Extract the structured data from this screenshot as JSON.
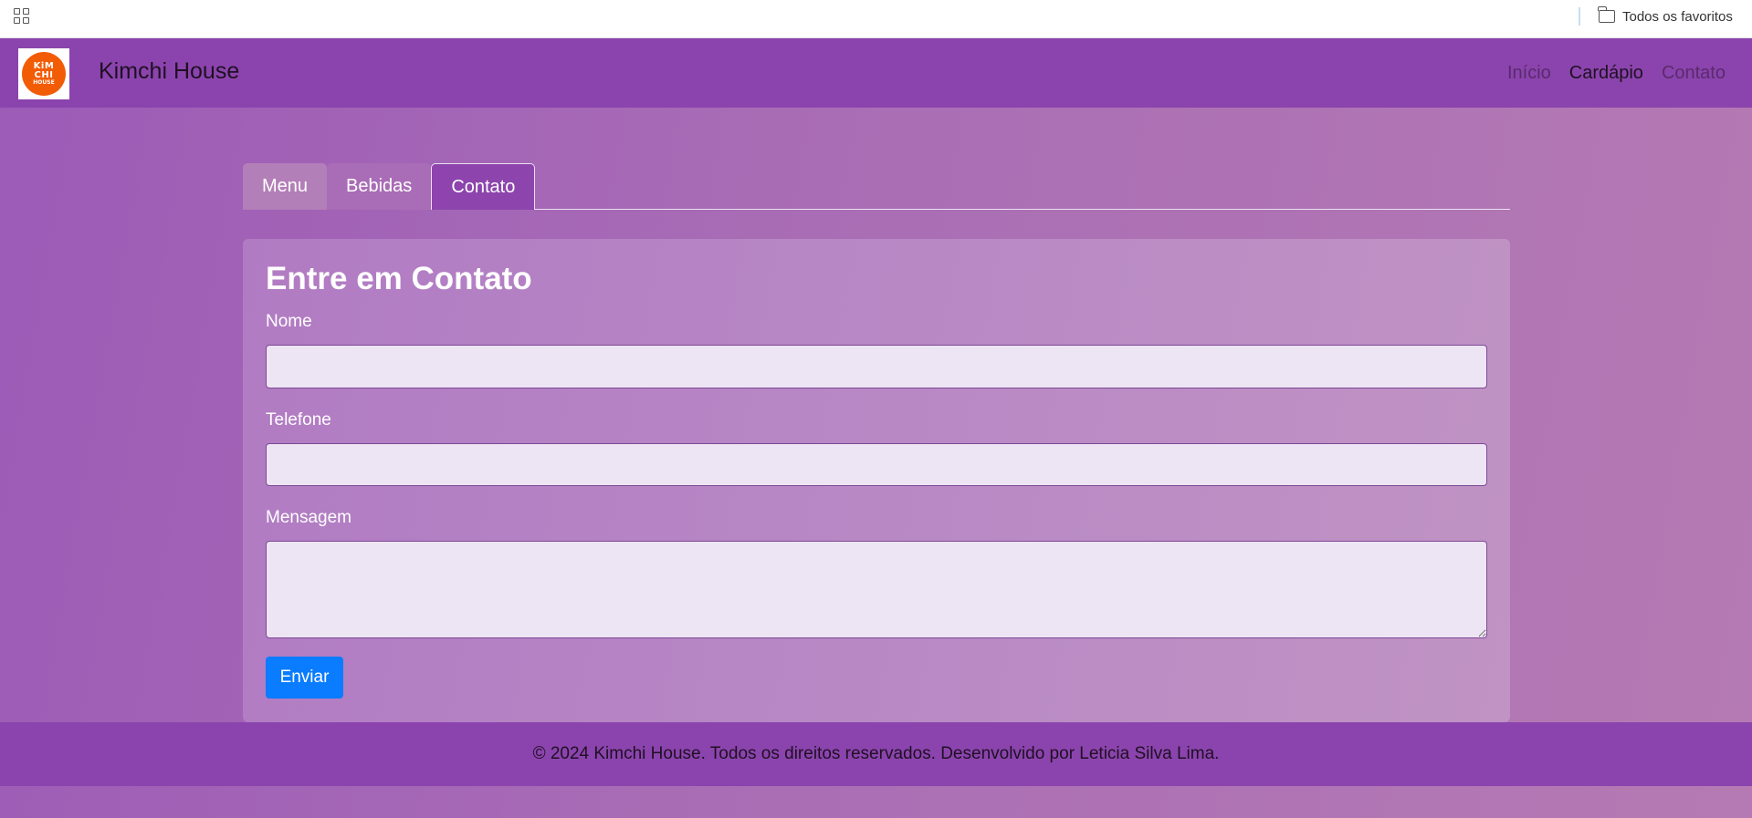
{
  "bookmarks_bar": {
    "folder_label": "Todos os favoritos"
  },
  "navbar": {
    "logo_text": [
      "KiM",
      "CHI",
      "HOUSE"
    ],
    "brand": "Kimchi House",
    "links": [
      {
        "label": "Início",
        "active": false
      },
      {
        "label": "Cardápio",
        "active": true
      },
      {
        "label": "Contato",
        "active": false
      }
    ]
  },
  "tabs": [
    {
      "label": "Menu",
      "selected": false
    },
    {
      "label": "Bebidas",
      "selected": false
    },
    {
      "label": "Contato",
      "selected": true
    }
  ],
  "contact_form": {
    "title": "Entre em Contato",
    "fields": [
      {
        "label": "Nome",
        "value": "",
        "placeholder": ""
      },
      {
        "label": "Telefone",
        "value": "",
        "placeholder": ""
      },
      {
        "label": "Mensagem",
        "value": "",
        "placeholder": ""
      }
    ],
    "submit_label": "Enviar"
  },
  "footer": {
    "text": "© 2024 Kimchi House. Todos os direitos reservados. Desenvolvido por Leticia Silva Lima."
  },
  "colors": {
    "navbar_bg": "#8b44ad",
    "page_bg_start": "#9c5bb7",
    "page_bg_end": "#b57ab3",
    "submit_button": "#0a7cff",
    "logo_orange": "#f25c05"
  }
}
